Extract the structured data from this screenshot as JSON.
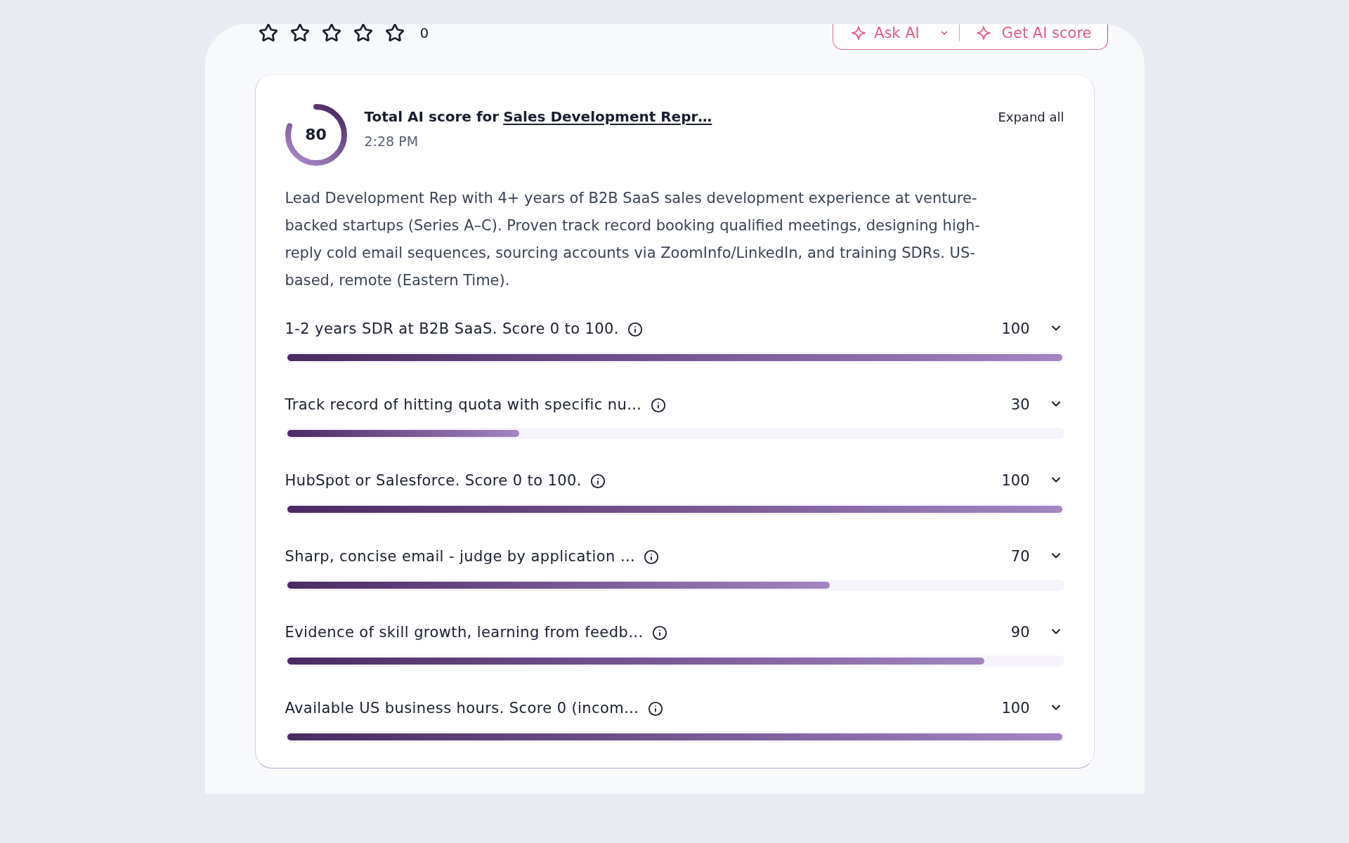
{
  "rating": {
    "stars": 0,
    "count": "0"
  },
  "ai_actions": [
    {
      "kind": "dropdown",
      "label": "Ask AI"
    },
    {
      "kind": "plain",
      "label": "Get AI score"
    }
  ],
  "score_card": {
    "score": "80",
    "level": 0.8,
    "title": "Total AI score for",
    "link": "Sales Development Repr…",
    "time": "2:28 PM",
    "expand_button": "Expand all",
    "summary": "Lead Development Rep with 4+ years of B2B SaaS sales development experience at venture-backed startups (Series A–C). Proven track record booking qualified meetings, designing high-reply cold email sequences, sourcing accounts via ZoomInfo/LinkedIn, and training SDRs. US-based, remote (Eastern Time).",
    "criteria": [
      {
        "label": "1-2 years SDR at B2B SaaS. Score 0 to 100.",
        "score": "100",
        "level": 1.0,
        "expanded": false
      },
      {
        "label": "Track record of hitting quota with specific nu…",
        "score": "30",
        "level": 0.3,
        "expanded": false
      },
      {
        "label": "HubSpot or Salesforce. Score 0 to 100.",
        "score": "100",
        "level": 1.0,
        "expanded": false
      },
      {
        "label": "Sharp, concise email - judge by application …",
        "score": "70",
        "level": 0.7,
        "expanded": false
      },
      {
        "label": "Evidence of skill growth, learning from feedb…",
        "score": "90",
        "level": 0.9,
        "expanded": false
      },
      {
        "label": "Available US business hours. Score 0 (incom…",
        "score": "100",
        "level": 1.0,
        "expanded": false
      }
    ]
  }
}
